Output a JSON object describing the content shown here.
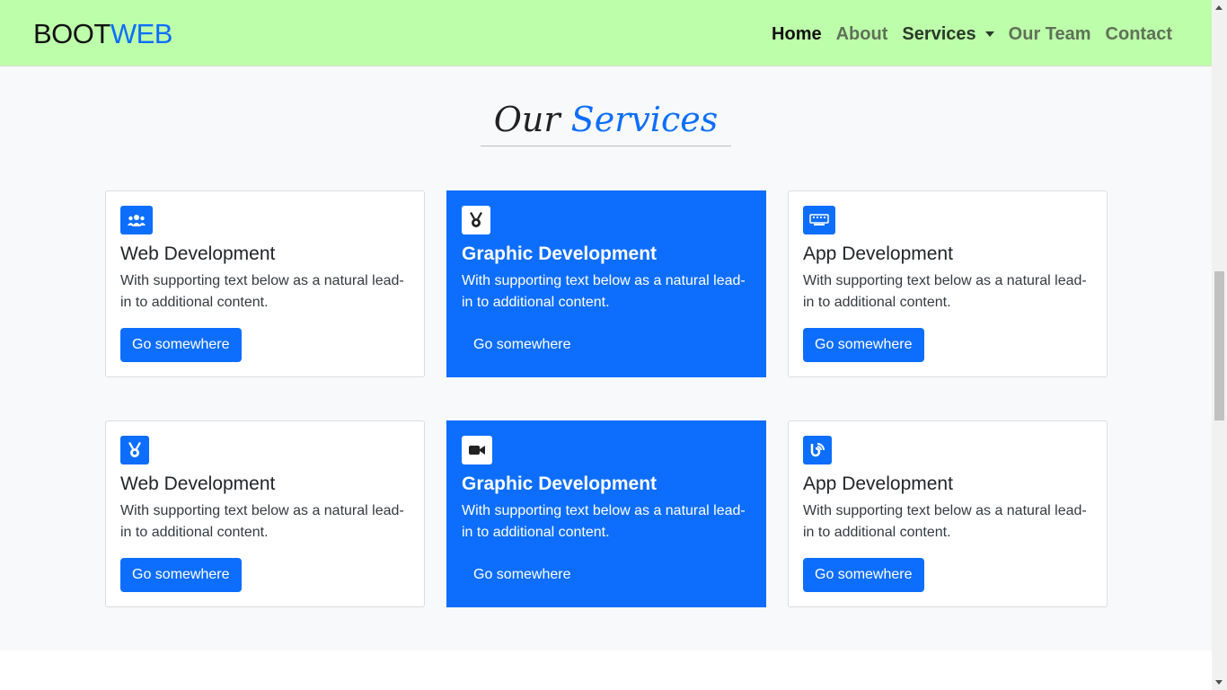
{
  "navbar": {
    "brand_prefix": "BOOT",
    "brand_accent": "WEB",
    "links": [
      {
        "label": "Home"
      },
      {
        "label": "About"
      },
      {
        "label": "Services"
      },
      {
        "label": "Our Team"
      },
      {
        "label": "Contact"
      }
    ]
  },
  "services": {
    "title_prefix": "Our",
    "title_accent": "Services",
    "cards": [
      {
        "icon": "users-icon",
        "title": "Web Development",
        "text": "With supporting text below as a natural lead-in to additional content.",
        "button": "Go somewhere"
      },
      {
        "icon": "medal-icon",
        "title": "Graphic Development",
        "text": "With supporting text below as a natural lead-in to additional content.",
        "button": "Go somewhere"
      },
      {
        "icon": "keyboard-icon",
        "title": "App Development",
        "text": "With supporting text below as a natural lead-in to additional content.",
        "button": "Go somewhere"
      },
      {
        "icon": "medal-icon",
        "title": "Web Development",
        "text": "With supporting text below as a natural lead-in to additional content.",
        "button": "Go somewhere"
      },
      {
        "icon": "video-icon",
        "title": "Graphic Development",
        "text": "With supporting text below as a natural lead-in to additional content.",
        "button": "Go somewhere"
      },
      {
        "icon": "blog-icon",
        "title": "App Development",
        "text": "With supporting text below as a natural lead-in to additional content.",
        "button": "Go somewhere"
      }
    ]
  },
  "colors": {
    "navbar_bg": "#bdfeaa",
    "accent": "#0d6efd",
    "section_bg": "#f8f9fa"
  }
}
